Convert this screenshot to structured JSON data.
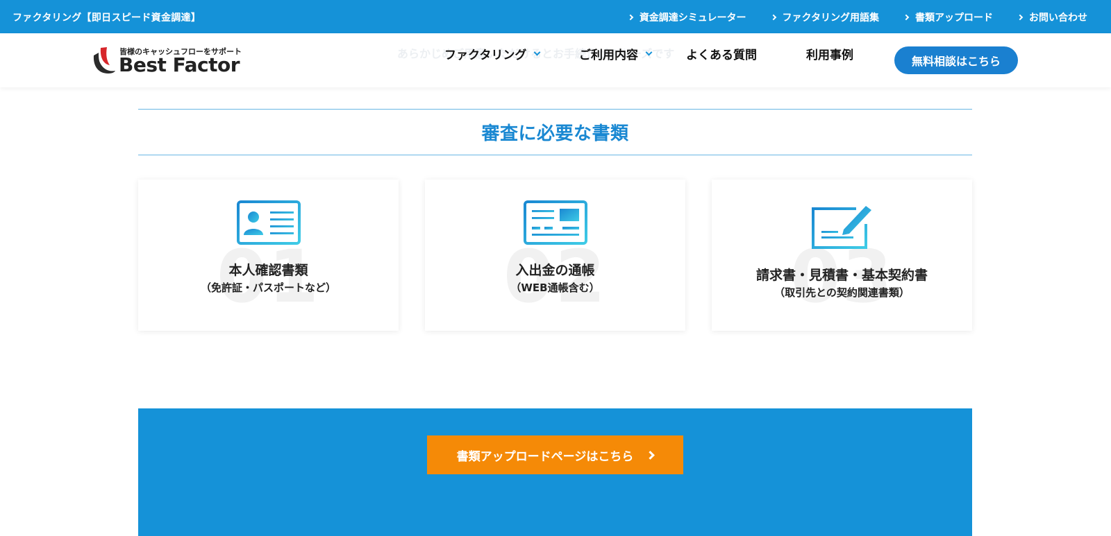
{
  "topbar": {
    "tagline": "ファクタリング【即日スピード資金調達】",
    "links": [
      {
        "label": "資金調達シミュレーター"
      },
      {
        "label": "ファクタリング用語集"
      },
      {
        "label": "書類アップロード"
      },
      {
        "label": "お問い合わせ"
      }
    ]
  },
  "header": {
    "ghost_text": "あらかじめご用意いただけるとお手続きがスムーズです",
    "logo": {
      "tagline": "皆様のキャッシュフローをサポート",
      "name": "Best Factor"
    },
    "nav": [
      {
        "label": "ファクタリング",
        "has_dropdown": true
      },
      {
        "label": "ご利用内容",
        "has_dropdown": true
      },
      {
        "label": "よくある質問",
        "has_dropdown": false
      },
      {
        "label": "利用事例",
        "has_dropdown": false
      }
    ],
    "cta_label": "無料相談はこちら"
  },
  "section": {
    "title": "審査に必要な書類",
    "cards": [
      {
        "number": "01",
        "title": "本人確認書類",
        "subtitle": "（免許証・パスポートなど）",
        "icon": "id-card-icon"
      },
      {
        "number": "02",
        "title": "入出金の通帳",
        "subtitle": "（WEB通帳含む）",
        "icon": "bankbook-icon"
      },
      {
        "number": "03",
        "title": "請求書・見積書・基本契約書",
        "subtitle": "（取引先との契約関連書類）",
        "icon": "document-pen-icon"
      }
    ]
  },
  "upload": {
    "button_label": "書類アップロードページはこちら"
  },
  "colors": {
    "primary_blue": "#1592d8",
    "cta_blue": "#1a80d0",
    "orange": "#f58a07",
    "logo_red": "#d7262b"
  }
}
